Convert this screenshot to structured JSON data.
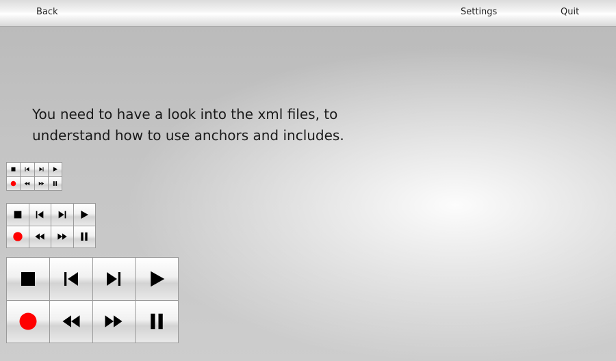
{
  "header": {
    "back_label": "Back",
    "settings_label": "Settings",
    "quit_label": "Quit"
  },
  "message": {
    "line1": "You need to have a look into the xml files, to",
    "line2": "understand how to use anchors and includes."
  },
  "transport_buttons": [
    {
      "icon": "stop-icon"
    },
    {
      "icon": "skip-back-icon"
    },
    {
      "icon": "skip-forward-icon"
    },
    {
      "icon": "play-icon"
    },
    {
      "icon": "record-icon"
    },
    {
      "icon": "rewind-icon"
    },
    {
      "icon": "fast-forward-icon"
    },
    {
      "icon": "pause-icon"
    }
  ],
  "colors": {
    "record": "#ff0000",
    "icon": "#000000"
  }
}
